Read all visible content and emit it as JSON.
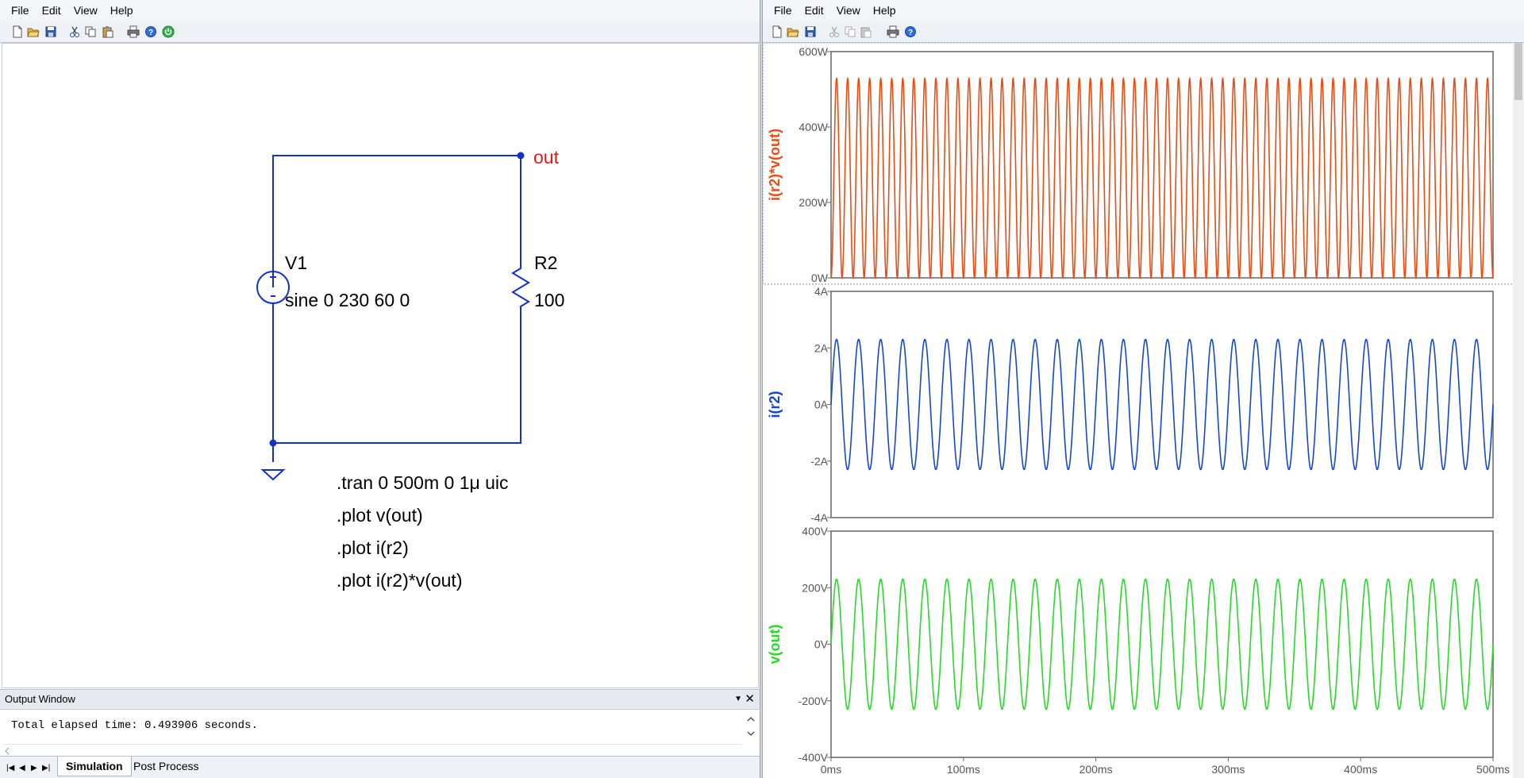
{
  "schematic_window": {
    "menu": [
      "File",
      "Edit",
      "View",
      "Help"
    ],
    "toolbar_icons": [
      "new-file-icon",
      "open-folder-icon",
      "save-icon",
      "cut-icon",
      "copy-icon",
      "paste-icon",
      "print-icon",
      "help-icon",
      "power-icon"
    ],
    "components": {
      "source_name": "V1",
      "source_value": "sine 0 230 60 0",
      "resistor_name": "R2",
      "resistor_value": "100",
      "net_label": "out"
    },
    "directives": [
      ".tran 0 500m 0 1μ uic",
      ".plot v(out)",
      ".plot i(r2)",
      ".plot i(r2)*v(out)"
    ],
    "output_window": {
      "title": "Output Window",
      "text": "Total elapsed time: 0.493906 seconds."
    },
    "tabs": [
      "Simulation",
      "Post Process"
    ],
    "active_tab": "Simulation"
  },
  "waveform_window": {
    "menu": [
      "File",
      "Edit",
      "View",
      "Help"
    ],
    "toolbar_icons": [
      "new-file-icon",
      "open-folder-icon",
      "save-icon",
      "cut-icon",
      "copy-icon",
      "paste-icon",
      "print-icon",
      "help-icon"
    ]
  },
  "chart_data": [
    {
      "type": "line",
      "ylabel": "i(r2)*v(out)",
      "color": "#ee4b12",
      "y_ticks": [
        "600W",
        "400W",
        "200W",
        "0W"
      ],
      "ylim": [
        0,
        600
      ],
      "x_ticks": [],
      "xlim": [
        0,
        0.5
      ],
      "series": [
        {
          "name": "i(r2)*v(out)",
          "waveform": "power",
          "amplitude": 529,
          "frequency_hz": 60,
          "x_start": 0,
          "x_end": 0.5
        }
      ]
    },
    {
      "type": "line",
      "ylabel": "i(r2)",
      "color": "#1348d6",
      "y_ticks": [
        "4A",
        "2A",
        "0A",
        "-2A",
        "-4A"
      ],
      "ylim": [
        -4,
        4
      ],
      "x_ticks": [],
      "xlim": [
        0,
        0.5
      ],
      "series": [
        {
          "name": "i(r2)",
          "waveform": "sine",
          "amplitude": 2.3,
          "frequency_hz": 60,
          "x_start": 0,
          "x_end": 0.5
        }
      ]
    },
    {
      "type": "line",
      "ylabel": "v(out)",
      "color": "#22dd22",
      "y_ticks": [
        "400V",
        "200V",
        "0V",
        "-200V",
        "-400V"
      ],
      "ylim": [
        -400,
        400
      ],
      "x_ticks": [
        "0ms",
        "100ms",
        "200ms",
        "300ms",
        "400ms",
        "500ms"
      ],
      "xlim": [
        0,
        0.5
      ],
      "series": [
        {
          "name": "v(out)",
          "waveform": "sine",
          "amplitude": 230,
          "frequency_hz": 60,
          "x_start": 0,
          "x_end": 0.5
        }
      ]
    }
  ]
}
